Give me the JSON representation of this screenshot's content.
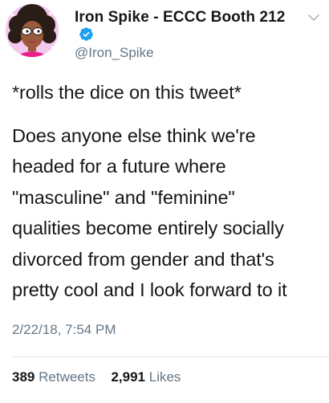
{
  "author": {
    "display_name": "Iron Spike - ECCC Booth 212",
    "handle": "@Iron_Spike",
    "verified": true,
    "avatar_icon": "cartoon-avatar-icon"
  },
  "tweet": {
    "lines": [
      "*rolls the dice on this tweet*",
      "Does anyone else think we're",
      "headed for a future where",
      "\"masculine\" and \"feminine\"",
      "qualities become entirely socially",
      "divorced from gender and that's",
      "pretty cool and I look forward to it"
    ],
    "timestamp": "2/22/18, 7:54 PM"
  },
  "stats": {
    "retweets_count": "389",
    "retweets_label": "Retweets",
    "likes_count": "2,991",
    "likes_label": "Likes"
  },
  "colors": {
    "text_primary": "#14171a",
    "text_secondary": "#657786",
    "verified_blue": "#1da1f2",
    "divider": "#e1e8ed"
  }
}
